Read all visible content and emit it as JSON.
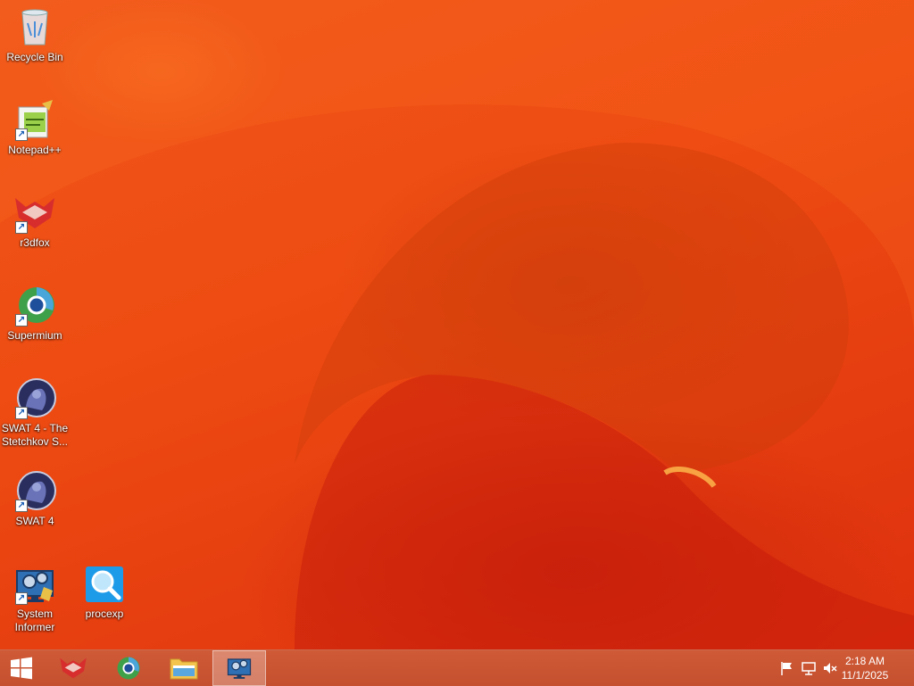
{
  "desktop": {
    "icons": [
      {
        "label": "Recycle Bin",
        "icon": "recycle-bin-icon"
      },
      {
        "label": "Notepad++",
        "icon": "notepad-plus-plus-icon"
      },
      {
        "label": "r3dfox",
        "icon": "r3dfox-icon"
      },
      {
        "label": "Supermium",
        "icon": "supermium-icon"
      },
      {
        "label": "SWAT 4 - The Stetchkov S...",
        "icon": "swat4-stetchkov-icon"
      },
      {
        "label": "SWAT 4",
        "icon": "swat4-icon"
      },
      {
        "label": "System Informer",
        "icon": "system-informer-icon"
      },
      {
        "label": "procexp",
        "icon": "procexp-icon"
      }
    ]
  },
  "taskbar": {
    "start": "start-button",
    "pinned": [
      "r3dfox",
      "Supermium",
      "File Explorer",
      "System Informer"
    ],
    "active": "System Informer",
    "tray": [
      "action-center-flag-icon",
      "network-icon",
      "volume-muted-icon"
    ],
    "clock": {
      "time": "2:18 AM",
      "date": "11/1/2025"
    }
  },
  "colors": {
    "wallpaper": "#ea4a10",
    "taskbar": "#c95532"
  }
}
